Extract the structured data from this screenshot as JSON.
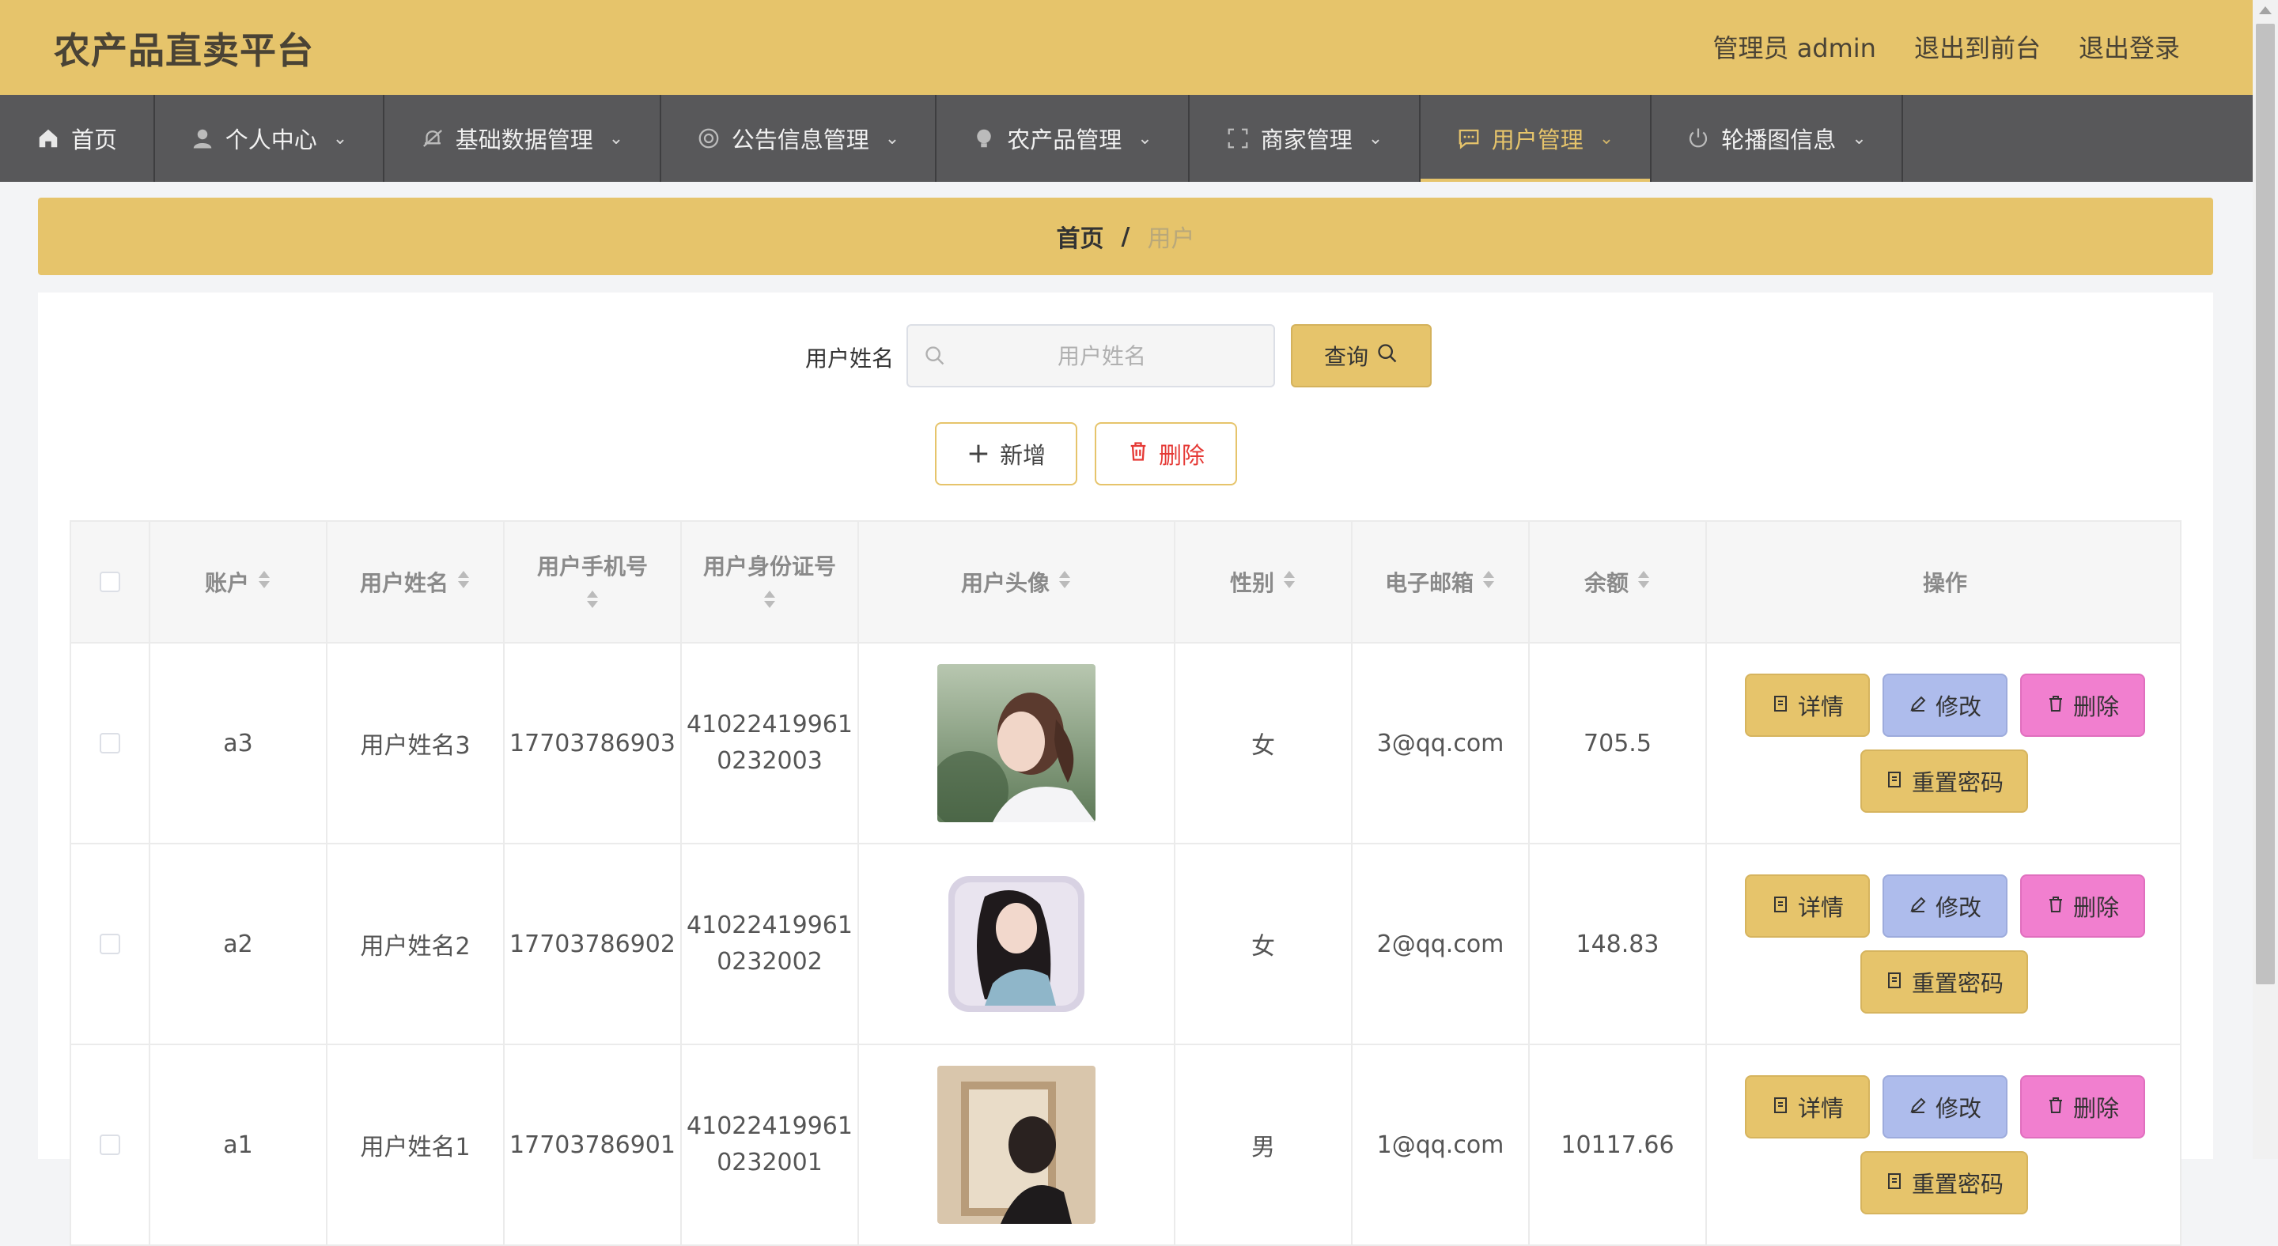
{
  "header": {
    "title": "农产品直卖平台",
    "links": [
      "管理员 admin",
      "退出到前台",
      "退出登录"
    ]
  },
  "nav": [
    {
      "label": "首页",
      "icon": "home-icon",
      "dropdown": false,
      "active": false
    },
    {
      "label": "个人中心",
      "icon": "user-icon",
      "dropdown": true,
      "active": false
    },
    {
      "label": "基础数据管理",
      "icon": "bell-off-icon",
      "dropdown": true,
      "active": false
    },
    {
      "label": "公告信息管理",
      "icon": "life-ring-icon",
      "dropdown": true,
      "active": false
    },
    {
      "label": "农产品管理",
      "icon": "bulb-icon",
      "dropdown": true,
      "active": false
    },
    {
      "label": "商家管理",
      "icon": "fullscreen-icon",
      "dropdown": true,
      "active": false
    },
    {
      "label": "用户管理",
      "icon": "chat-icon",
      "dropdown": true,
      "active": true
    },
    {
      "label": "轮播图信息",
      "icon": "power-icon",
      "dropdown": true,
      "active": false
    }
  ],
  "breadcrumb": {
    "home": "首页",
    "separator": "/",
    "current": "用户"
  },
  "search": {
    "label": "用户姓名",
    "placeholder": "用户姓名",
    "value": "",
    "button": "查询"
  },
  "actions": {
    "add": "新增",
    "delete": "删除"
  },
  "table": {
    "columns": [
      "账户",
      "用户姓名",
      "用户手机号",
      "用户身份证号",
      "用户头像",
      "性别",
      "电子邮箱",
      "余额",
      "操作"
    ],
    "rows": [
      {
        "account": "a3",
        "name": "用户姓名3",
        "phone": "17703786903",
        "id_line1": "41022419961",
        "id_line2": "0232003",
        "gender": "女",
        "email": "3@qq.com",
        "balance": "705.5"
      },
      {
        "account": "a2",
        "name": "用户姓名2",
        "phone": "17703786902",
        "id_line1": "41022419961",
        "id_line2": "0232002",
        "gender": "女",
        "email": "2@qq.com",
        "balance": "148.83"
      },
      {
        "account": "a1",
        "name": "用户姓名1",
        "phone": "17703786901",
        "id_line1": "41022419961",
        "id_line2": "0232001",
        "gender": "男",
        "email": "1@qq.com",
        "balance": "10117.66"
      }
    ],
    "ops": {
      "detail": "详情",
      "edit": "修改",
      "delete": "删除",
      "reset": "重置密码"
    }
  },
  "colors": {
    "accent": "#e6c46b",
    "nav_bg": "#58585a",
    "edit_btn": "#aebcec",
    "delete_btn": "#f17fcf",
    "danger_text": "#e53935"
  }
}
